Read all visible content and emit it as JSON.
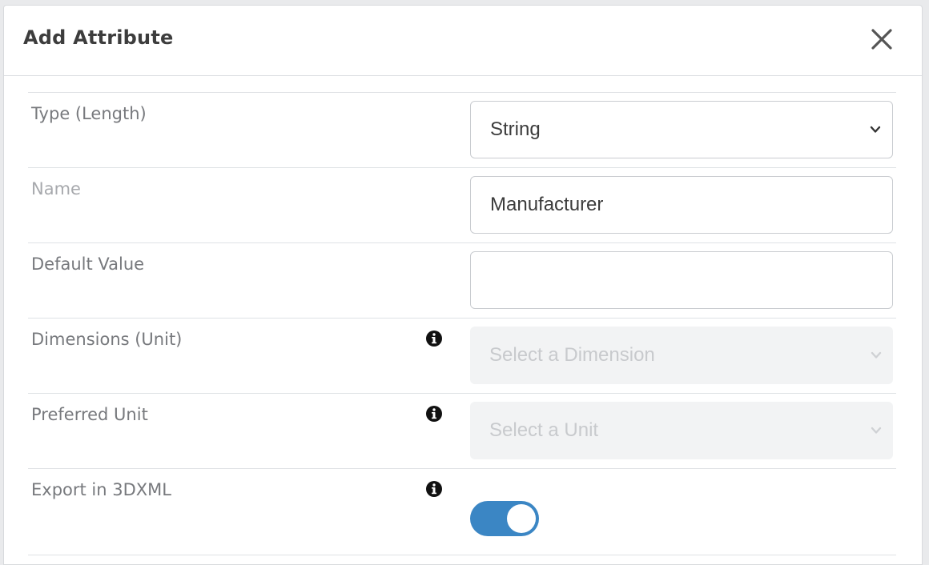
{
  "dialog": {
    "title": "Add Attribute",
    "close_icon": "close-icon"
  },
  "fields": {
    "type": {
      "label": "Type (Length)",
      "value": "String"
    },
    "name": {
      "label": "Name",
      "value": "Manufacturer"
    },
    "default_value": {
      "label": "Default Value",
      "value": ""
    },
    "dimensions": {
      "label": "Dimensions (Unit)",
      "placeholder": "Select a Dimension",
      "info_icon": "info-icon"
    },
    "preferred_unit": {
      "label": "Preferred Unit",
      "placeholder": "Select a Unit",
      "info_icon": "info-icon"
    },
    "export_3dxml": {
      "label": "Export in 3DXML",
      "enabled": true,
      "info_icon": "info-icon"
    }
  },
  "colors": {
    "toggle_on": "#3b86c4",
    "label": "#77797d",
    "title": "#3d3d3d"
  }
}
